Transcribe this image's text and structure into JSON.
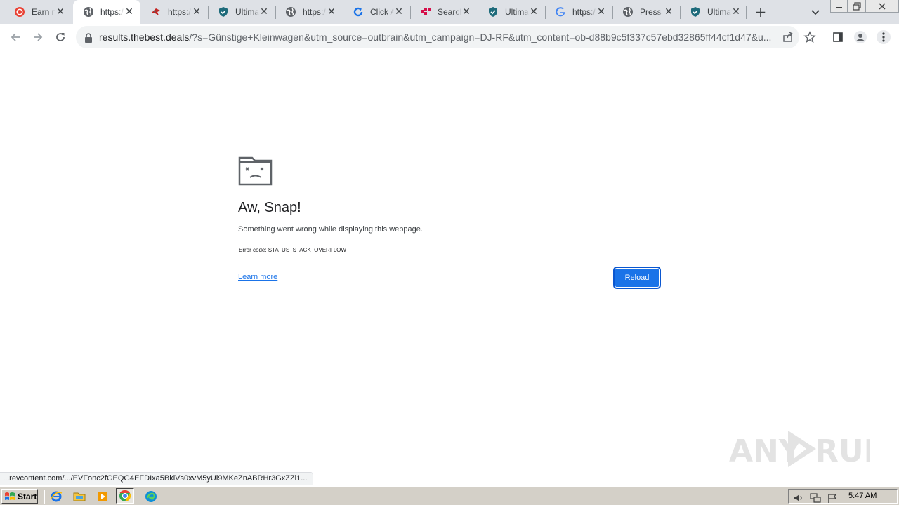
{
  "browser": {
    "tabs": [
      {
        "label": "Earn m",
        "icon": "record-icon",
        "active": false
      },
      {
        "label": "https:/",
        "icon": "globe-icon",
        "active": true
      },
      {
        "label": "https:/",
        "icon": "bird-icon",
        "active": false
      },
      {
        "label": "Ultima",
        "icon": "shield-icon",
        "active": false
      },
      {
        "label": "https:/",
        "icon": "globe-icon",
        "active": false
      },
      {
        "label": "Click Al",
        "icon": "refresh-icon",
        "active": false
      },
      {
        "label": "Search",
        "icon": "search-brand-icon",
        "active": false
      },
      {
        "label": "Ultima",
        "icon": "shield-icon",
        "active": false
      },
      {
        "label": "https:/",
        "icon": "google-icon",
        "active": false
      },
      {
        "label": "Press",
        "icon": "globe-icon",
        "active": false
      },
      {
        "label": "Ultima",
        "icon": "shield-icon",
        "active": false
      }
    ],
    "url_host": "results.thebest.deals",
    "url_rest": "/?s=Günstige+Kleinwagen&utm_source=outbrain&utm_campaign=DJ-RF&utm_content=ob-d88b9c5f337c57ebd32865ff44cf1d47&u..."
  },
  "error_page": {
    "title": "Aw, Snap!",
    "message": "Something went wrong while displaying this webpage.",
    "error_code": "Error code: STATUS_STACK_OVERFLOW",
    "learn_more": "Learn more",
    "reload": "Reload"
  },
  "status_bar": {
    "text": "...revcontent.com/.../EVFonc2fGEQG4EFDIxa5BklVs0xvM5yUl9MKeZnABRHr3GxZZl1..."
  },
  "watermark": {
    "text": "ANY RUN"
  },
  "taskbar": {
    "start_label": "Start",
    "clock": "5:47 AM"
  },
  "colors": {
    "accent": "#1a73e8",
    "tabstrip": "#dee1e6",
    "taskbar": "#d4d0c8"
  }
}
